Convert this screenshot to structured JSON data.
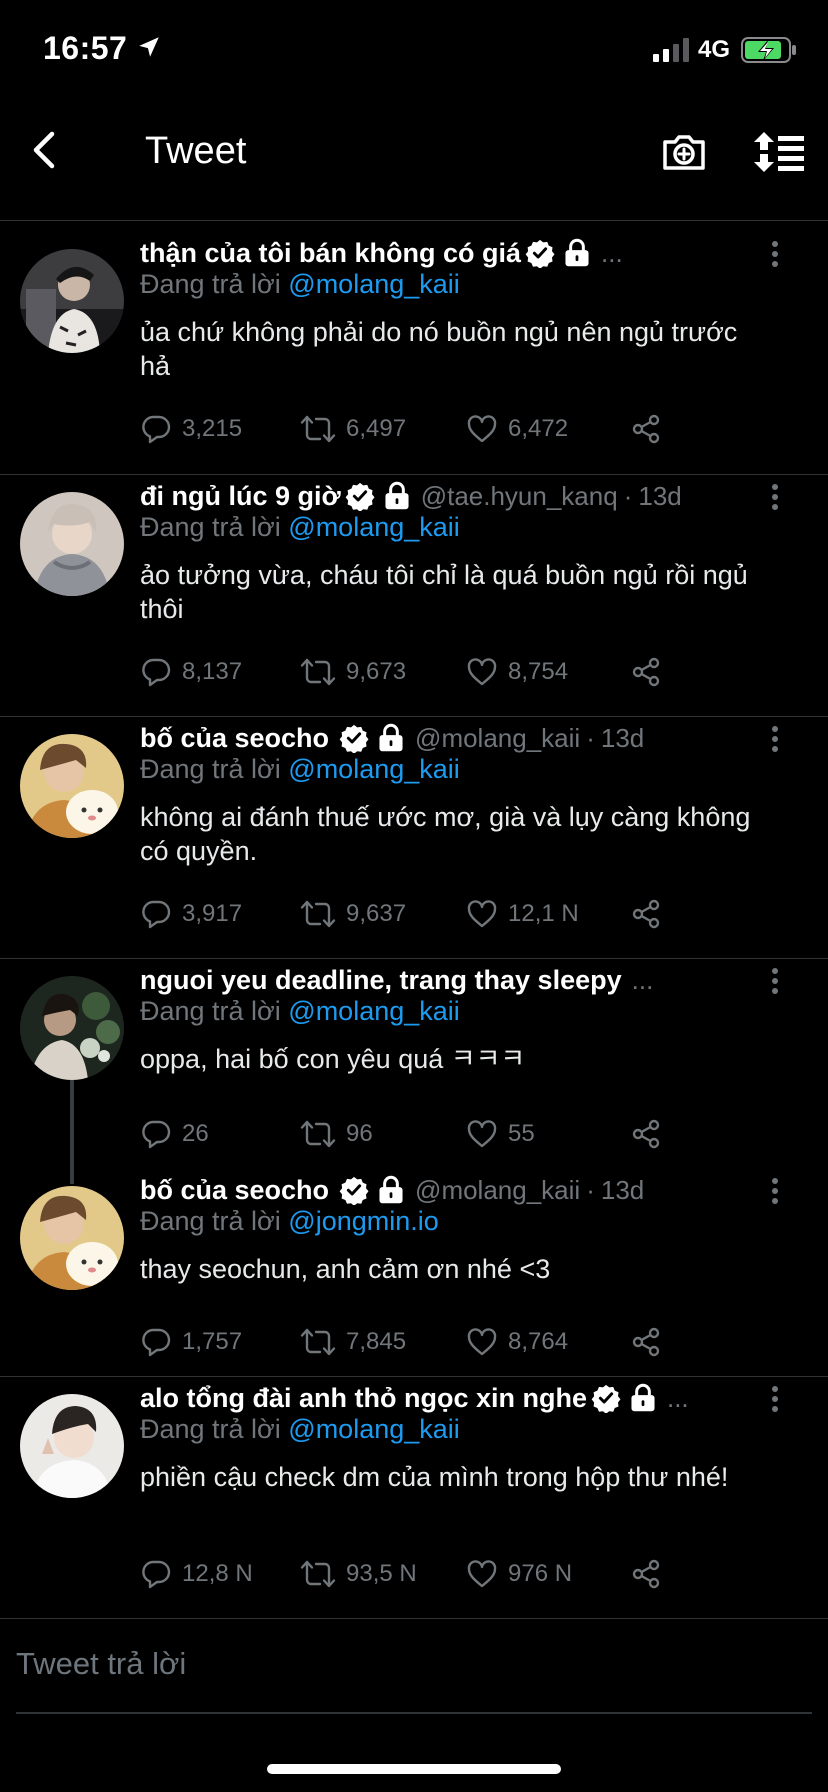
{
  "status_bar": {
    "time": "16:57",
    "network": "4G"
  },
  "header": {
    "title": "Tweet"
  },
  "compose": {
    "placeholder": "Tweet trả lời"
  },
  "colors": {
    "background": "#000000",
    "accent": "#1d9bf0",
    "muted": "#71767b",
    "divider": "#2f3336",
    "battery": "#4cd964"
  },
  "tweets": [
    {
      "name": "thận của tôi bán không có giá",
      "ellipsis": "...",
      "reply_label": "Đang trả lời",
      "reply_to": "@molang_kaii",
      "text": "ủa chứ không phải do nó buồn ngủ nên ngủ trước hả",
      "replies": "3,215",
      "retweets": "6,497",
      "likes": "6,472"
    },
    {
      "name": "đi ngủ lúc 9 giờ",
      "handle": "@tae.hyun_kanq",
      "dot": "·",
      "time": "13d",
      "reply_label": "Đang trả lời",
      "reply_to": "@molang_kaii",
      "text": "ảo tưởng vừa, cháu tôi chỉ là quá buồn ngủ rồi ngủ thôi",
      "replies": "8,137",
      "retweets": "9,673",
      "likes": "8,754"
    },
    {
      "name": "bố của seocho",
      "handle": "@molang_kaii",
      "dot": "·",
      "time": "13d",
      "reply_label": "Đang trả lời",
      "reply_to": "@molang_kaii",
      "text": "không ai đánh thuế ước mơ, già và lụy càng không có quyền.",
      "replies": "3,917",
      "retweets": "9,637",
      "likes": "12,1 N"
    },
    {
      "name": "nguoi yeu deadline, trang thay sleepy",
      "ellipsis": "...",
      "reply_label": "Đang trả lời",
      "reply_to": "@molang_kaii",
      "text": "oppa, hai bố con yêu quá ㅋㅋㅋ",
      "replies": "26",
      "retweets": "96",
      "likes": "55"
    },
    {
      "name": "bố của seocho",
      "handle": "@molang_kaii",
      "dot": "·",
      "time": "13d",
      "reply_label": "Đang trả lời",
      "reply_to": "@jongmin.io",
      "text": "thay seochun, anh cảm ơn nhé <3",
      "replies": "1,757",
      "retweets": "7,845",
      "likes": "8,764"
    },
    {
      "name": "alo tổng đài anh thỏ ngọc xin nghe",
      "ellipsis": "...",
      "reply_label": "Đang trả lời",
      "reply_to": "@molang_kaii",
      "text": "phiền cậu check dm của mình trong hộp thư nhé!",
      "replies": "12,8 N",
      "retweets": "93,5 N",
      "likes": "976 N"
    }
  ]
}
